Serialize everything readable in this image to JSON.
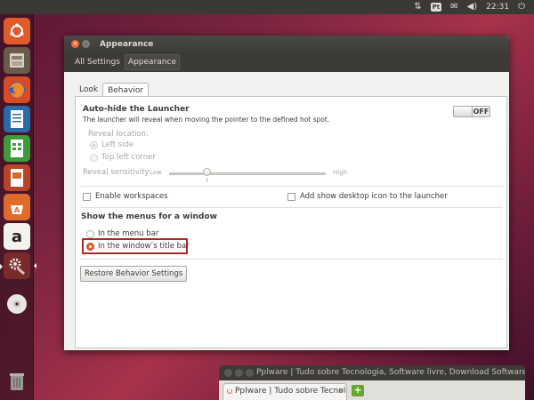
{
  "top_panel": {
    "keyboard_layout": "Pt",
    "volume_icon": "volume-icon",
    "network_icon": "network-arrows-icon",
    "email_icon": "envelope-icon",
    "clock": "22:31",
    "session_icon": "power-icon"
  },
  "launcher": {
    "items": [
      {
        "name": "ubuntu-dash",
        "icon": "ubuntu-logo-icon"
      },
      {
        "name": "files",
        "icon": "file-cabinet-icon"
      },
      {
        "name": "firefox",
        "icon": "firefox-icon"
      },
      {
        "name": "libreoffice-writer",
        "icon": "writer-icon"
      },
      {
        "name": "libreoffice-calc",
        "icon": "calc-icon"
      },
      {
        "name": "libreoffice-impress",
        "icon": "impress-icon"
      },
      {
        "name": "ubuntu-software-center",
        "icon": "software-center-icon"
      },
      {
        "name": "amazon",
        "icon": "amazon-icon"
      },
      {
        "name": "system-settings",
        "icon": "settings-gears-icon"
      },
      {
        "name": "dvd",
        "icon": "disc-icon"
      },
      {
        "name": "trash",
        "icon": "trash-icon"
      }
    ]
  },
  "window": {
    "title": "Appearance",
    "breadcrumbs": [
      "All Settings",
      "Appearance"
    ],
    "tabs": [
      "Look",
      "Behavior"
    ],
    "autohide": {
      "title": "Auto-hide the Launcher",
      "description": "The launcher will reveal when moving the pointer to the defined hot spot.",
      "toggle_state": "OFF",
      "reveal_location_label": "Reveal location:",
      "reveal_options": [
        "Left side",
        "Top left corner"
      ],
      "reveal_selected": "Left side",
      "sensitivity_label": "Reveal sensitivity",
      "sensitivity_low": "Low",
      "sensitivity_high": "High",
      "sensitivity_level": 0.23
    },
    "enable_workspaces": "Enable workspaces",
    "show_desktop_icon": "Add show desktop icon to the launcher",
    "menus_title": "Show the menus for a window",
    "menu_options": [
      "In the menu bar",
      "In the window’s title bar"
    ],
    "menu_selected": "In the window’s title bar",
    "restore_button": "Restore Behavior Settings"
  },
  "browser": {
    "title": "Pplware | Tudo sobre Tecnologia, Software livre, Download Software,",
    "tab_label": "Pplware | Tudo sobre Tecnolo...",
    "new_tab_glyph": "+"
  },
  "colors": {
    "accent": "#e4602d",
    "highlight": "#b02525",
    "panel": "#3c3b37"
  }
}
